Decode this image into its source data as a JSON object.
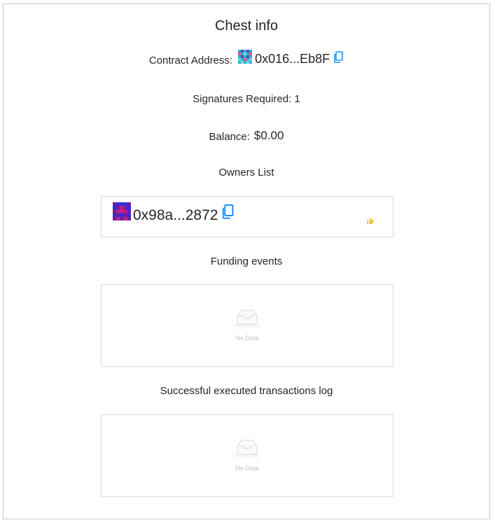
{
  "title": "Chest info",
  "contract": {
    "label": "Contract Address:",
    "address": "0x016...Eb8F",
    "icon": "copy-icon"
  },
  "signatures": {
    "text": "Signatures Required: 1"
  },
  "balance": {
    "label": "Balance:",
    "value": "$0.00"
  },
  "owners": {
    "title": "Owners List",
    "items": [
      {
        "address": "0x98a...2872",
        "icon": "copy-icon",
        "status_icon": "thumbs-up-icon"
      }
    ]
  },
  "funding": {
    "title": "Funding events",
    "empty_text": "No Data"
  },
  "transactions": {
    "title": "Successful executed transactions log",
    "empty_text": "No Data"
  },
  "colors": {
    "accent": "#1890ff",
    "border": "#d9d9d9",
    "empty_text": "#bfbfbf",
    "thumb": "#f5c343"
  }
}
